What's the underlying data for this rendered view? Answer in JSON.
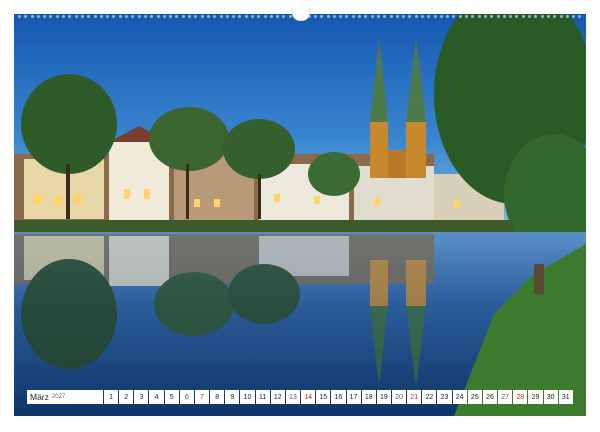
{
  "calendar": {
    "month": "März",
    "year": "2027",
    "days": [
      {
        "n": "1",
        "type": "weekday"
      },
      {
        "n": "2",
        "type": "weekday"
      },
      {
        "n": "3",
        "type": "weekday"
      },
      {
        "n": "4",
        "type": "weekday"
      },
      {
        "n": "5",
        "type": "weekday"
      },
      {
        "n": "6",
        "type": "saturday"
      },
      {
        "n": "7",
        "type": "sunday"
      },
      {
        "n": "8",
        "type": "weekday"
      },
      {
        "n": "9",
        "type": "weekday"
      },
      {
        "n": "10",
        "type": "weekday"
      },
      {
        "n": "11",
        "type": "weekday"
      },
      {
        "n": "12",
        "type": "weekday"
      },
      {
        "n": "13",
        "type": "saturday"
      },
      {
        "n": "14",
        "type": "sunday"
      },
      {
        "n": "15",
        "type": "weekday"
      },
      {
        "n": "16",
        "type": "weekday"
      },
      {
        "n": "17",
        "type": "weekday"
      },
      {
        "n": "18",
        "type": "weekday"
      },
      {
        "n": "19",
        "type": "weekday"
      },
      {
        "n": "20",
        "type": "saturday"
      },
      {
        "n": "21",
        "type": "sunday"
      },
      {
        "n": "22",
        "type": "weekday"
      },
      {
        "n": "23",
        "type": "weekday"
      },
      {
        "n": "24",
        "type": "weekday"
      },
      {
        "n": "25",
        "type": "weekday"
      },
      {
        "n": "26",
        "type": "weekday"
      },
      {
        "n": "27",
        "type": "saturday"
      },
      {
        "n": "28",
        "type": "sunday"
      },
      {
        "n": "29",
        "type": "weekday"
      },
      {
        "n": "30",
        "type": "weekday"
      },
      {
        "n": "31",
        "type": "weekday"
      }
    ]
  },
  "colors": {
    "sunday": "#d22222",
    "sky": "#1a5fb4",
    "water": "#0f3567",
    "towers": "#c8892e"
  }
}
